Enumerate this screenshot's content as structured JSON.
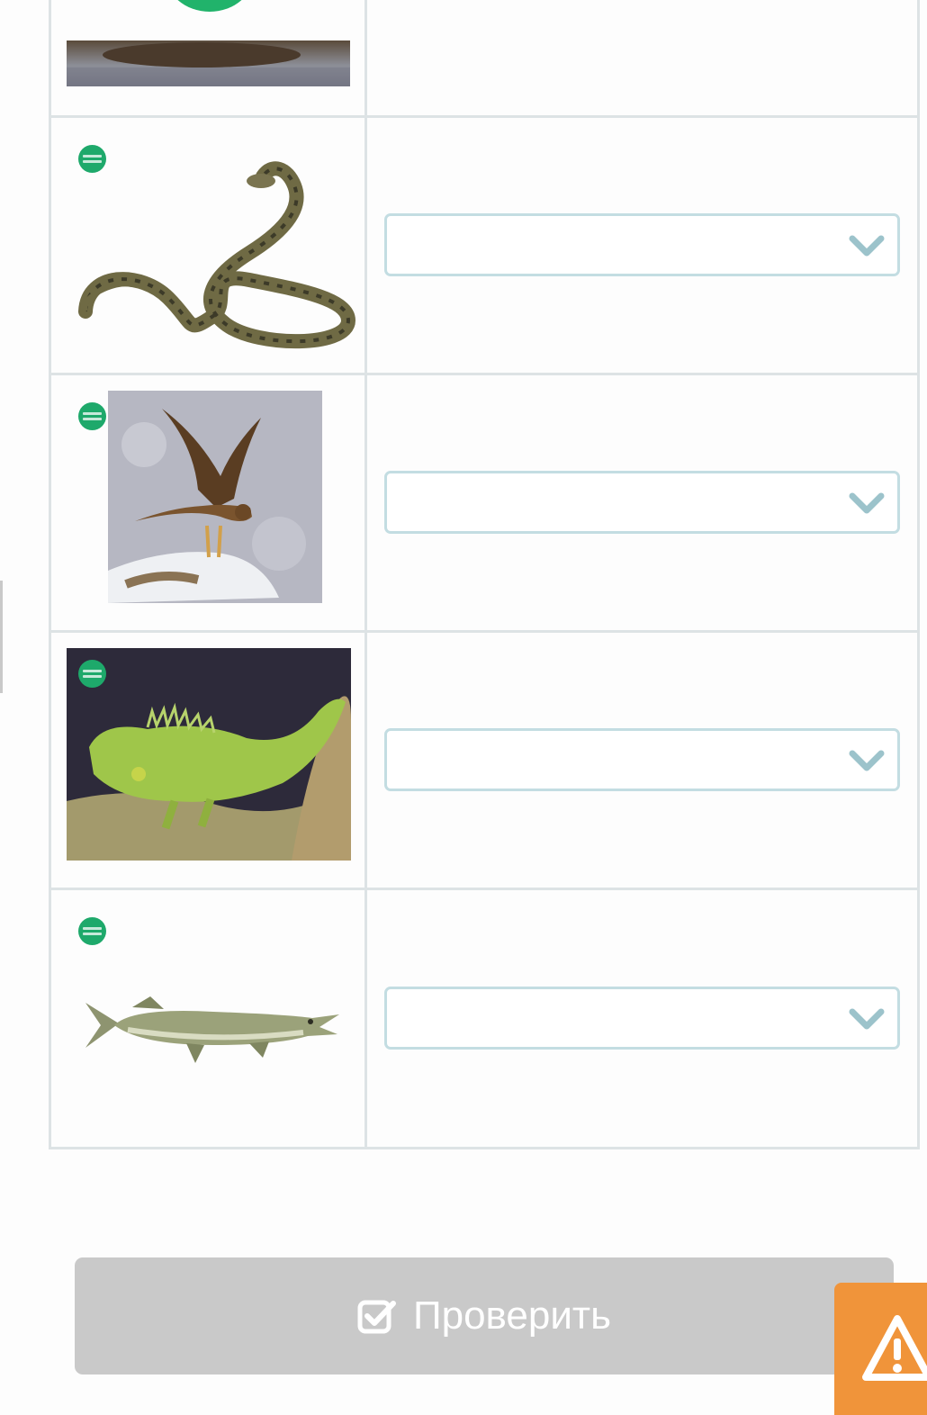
{
  "rows": [
    {
      "animal_icon": "cow-icon",
      "select_value": ""
    },
    {
      "animal_icon": "snake-icon",
      "select_value": ""
    },
    {
      "animal_icon": "eagle-icon",
      "select_value": ""
    },
    {
      "animal_icon": "iguana-icon",
      "select_value": ""
    },
    {
      "animal_icon": "pike-fish-icon",
      "select_value": ""
    }
  ],
  "check_button": {
    "label": "Проверить",
    "icon": "check-square-icon"
  },
  "warning_button": {
    "icon": "warning-icon"
  },
  "colors": {
    "button_bg": "#c9c9c9",
    "warning_bg": "#f0943a",
    "badge": "#1ea96b",
    "select_border": "#c3dde2",
    "chevron": "#9cc3cb"
  }
}
